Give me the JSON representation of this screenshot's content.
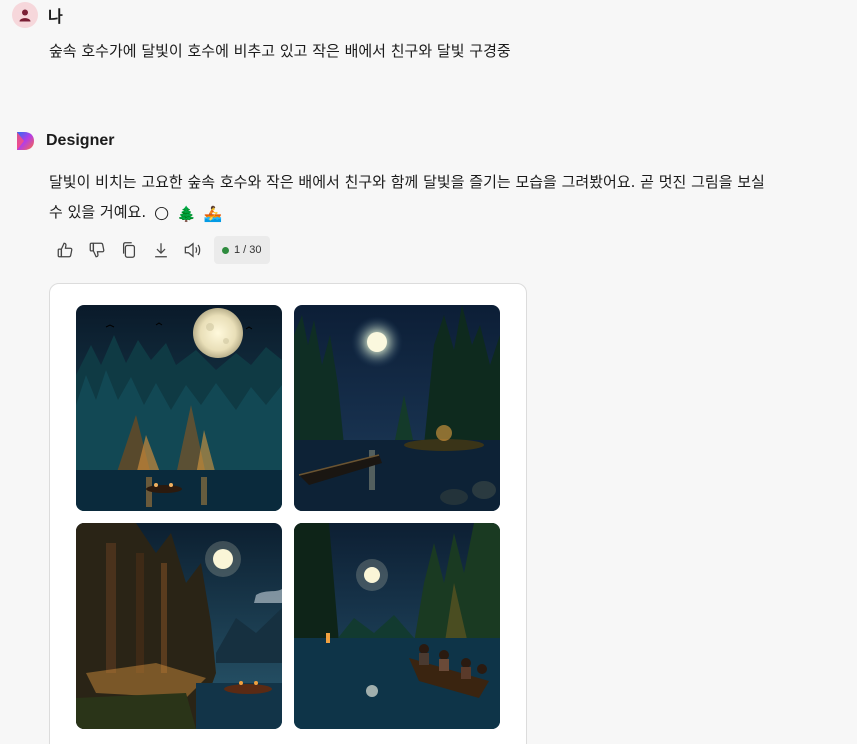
{
  "user_message": {
    "sender": "나",
    "text": "숲속 호수가에 달빛이 호수에 비추고 있고 작은 배에서 친구와 달빛 구경중"
  },
  "assistant_message": {
    "sender": "Designer",
    "text_line1": "달빛이 비치는 고요한 숲속 호수와 작은 배에서 친구와 함께 달빛을 즐기는 모습을 그려봤어요. 곧 멋진 그림을 보실",
    "text_line2": "수 있을 거예요.",
    "emojis": [
      "🌕",
      "🌲",
      "🚣"
    ]
  },
  "actions": {
    "icons": [
      "thumbs-up-icon",
      "thumbs-down-icon",
      "copy-icon",
      "download-icon",
      "speaker-icon"
    ],
    "counter": "1 / 30",
    "counter_status_color": "#2e8b3e"
  },
  "images": [
    {
      "name": "moonlit-forest-lake-image-1"
    },
    {
      "name": "moonlit-forest-lake-image-2"
    },
    {
      "name": "moonlit-forest-lake-image-3"
    },
    {
      "name": "moonlit-forest-lake-image-4"
    }
  ],
  "colors": {
    "background": "#f7f7f7",
    "card_border": "#dcdcdc",
    "user_avatar_bg": "#f6d7db"
  }
}
